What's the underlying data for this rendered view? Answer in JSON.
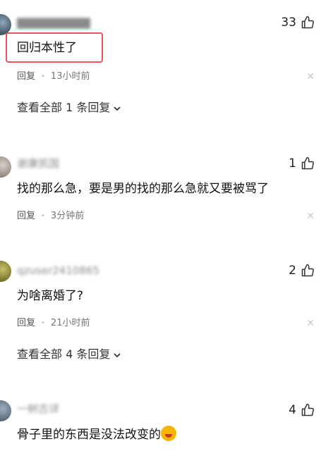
{
  "comments": [
    {
      "username": "▇▇▇▇▇▇▇▇▇",
      "likes": "33",
      "text": "回归本性了",
      "reply_label": "回复",
      "time": "13小时前",
      "view_all": "查看全部 1 条回复"
    },
    {
      "username": "谢康凯国",
      "likes": "1",
      "text": "找的那么急，要是男的找的那么急就又要被骂了",
      "reply_label": "回复",
      "time": "3分钟前"
    },
    {
      "username": "qzuser2410865",
      "likes": "2",
      "text": "为啥离婚了?",
      "reply_label": "回复",
      "time": "21小时前",
      "view_all": "查看全部 4 条回复"
    },
    {
      "username": "一树古详",
      "likes": "4",
      "text": "骨子里的东西是没法改变的"
    }
  ],
  "icons": {
    "like": "thumbs-up-icon",
    "close": "close-icon",
    "expand": "chevron-down-icon",
    "emoji": "laughing-crying-emoji"
  },
  "colors": {
    "highlight_border": "#f0505a",
    "text": "#111111",
    "meta": "#777777"
  }
}
